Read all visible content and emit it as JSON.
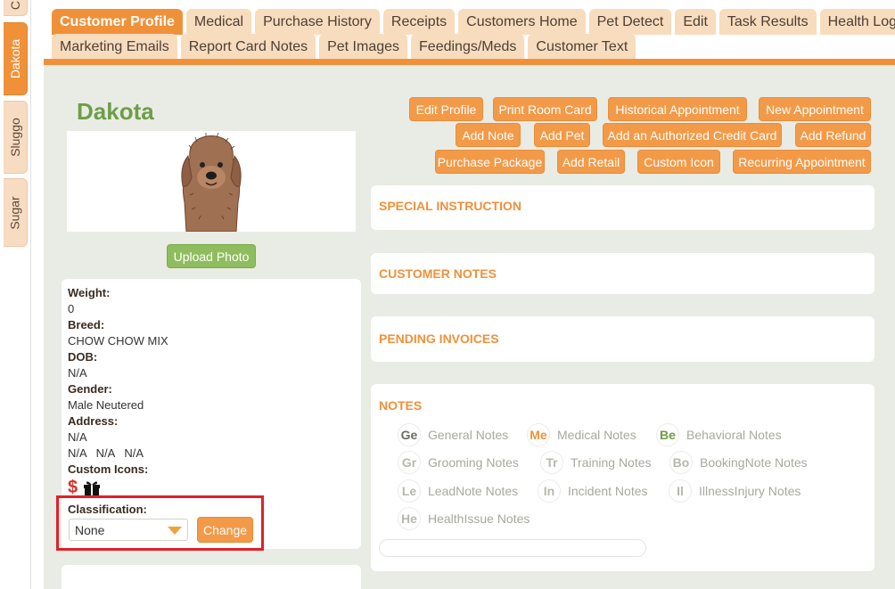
{
  "pet_tabs": [
    {
      "label": "C"
    },
    {
      "label": "Dakota"
    },
    {
      "label": "Sluggo"
    },
    {
      "label": "Sugar"
    }
  ],
  "tabs_row1": [
    {
      "label": "Customer Profile"
    },
    {
      "label": "Medical"
    },
    {
      "label": "Purchase History"
    },
    {
      "label": "Receipts"
    },
    {
      "label": "Customers Home"
    },
    {
      "label": "Pet Detect"
    },
    {
      "label": "Edit"
    },
    {
      "label": "Task Results"
    },
    {
      "label": "Health Log"
    }
  ],
  "tabs_row2": [
    {
      "label": "Marketing Emails"
    },
    {
      "label": "Report Card Notes"
    },
    {
      "label": "Pet Images"
    },
    {
      "label": "Feedings/Meds"
    },
    {
      "label": "Customer Text"
    }
  ],
  "pet": {
    "name": "Dakota",
    "upload_label": "Upload Photo"
  },
  "info": {
    "weight_label": "Weight:",
    "weight": "0",
    "breed_label": "Breed:",
    "breed": "CHOW CHOW MIX",
    "dob_label": "DOB:",
    "dob": "N/A",
    "gender_label": "Gender:",
    "gender": "Male Neutered",
    "address_label": "Address:",
    "address_line1": "N/A",
    "address_line2": [
      "N/A",
      "N/A",
      "N/A"
    ],
    "custom_icons_label": "Custom Icons:",
    "dollar_symbol": "$",
    "classification_label": "Classification:",
    "classification_value": "None",
    "change_label": "Change"
  },
  "actions": {
    "edit_profile": "Edit Profile",
    "print_room_card": "Print Room Card",
    "historical_appointment": "Historical Appointment",
    "new_appointment": "New Appointment",
    "add_note": "Add Note",
    "add_pet": "Add Pet",
    "add_credit_card": "Add an Authorized Credit Card",
    "add_refund": "Add Refund",
    "purchase_package": "Purchase Package",
    "add_retail": "Add Retail",
    "custom_icon": "Custom Icon",
    "recurring_appointment": "Recurring Appointment"
  },
  "panels": {
    "special_instruction": "SPECIAL INSTRUCTION",
    "customer_notes": "CUSTOMER NOTES",
    "pending_invoices": "PENDING INVOICES",
    "notes": "NOTES"
  },
  "notes": [
    {
      "abbr": "Ge",
      "label": "General Notes"
    },
    {
      "abbr": "Me",
      "label": "Medical Notes"
    },
    {
      "abbr": "Be",
      "label": "Behavioral Notes"
    },
    {
      "abbr": "Gr",
      "label": "Grooming Notes"
    },
    {
      "abbr": "Tr",
      "label": "Training Notes"
    },
    {
      "abbr": "Bo",
      "label": "BookingNote Notes"
    },
    {
      "abbr": "Le",
      "label": "LeadNote Notes"
    },
    {
      "abbr": "In",
      "label": "Incident Notes"
    },
    {
      "abbr": "Il",
      "label": "IllnessInjury Notes"
    },
    {
      "abbr": "He",
      "label": "HealthIssue Notes"
    }
  ],
  "colors": {
    "accent": "#f0913a",
    "pet_name": "#6d9e48",
    "upload": "#8fbd5e",
    "highlight_box": "#e0202a"
  }
}
